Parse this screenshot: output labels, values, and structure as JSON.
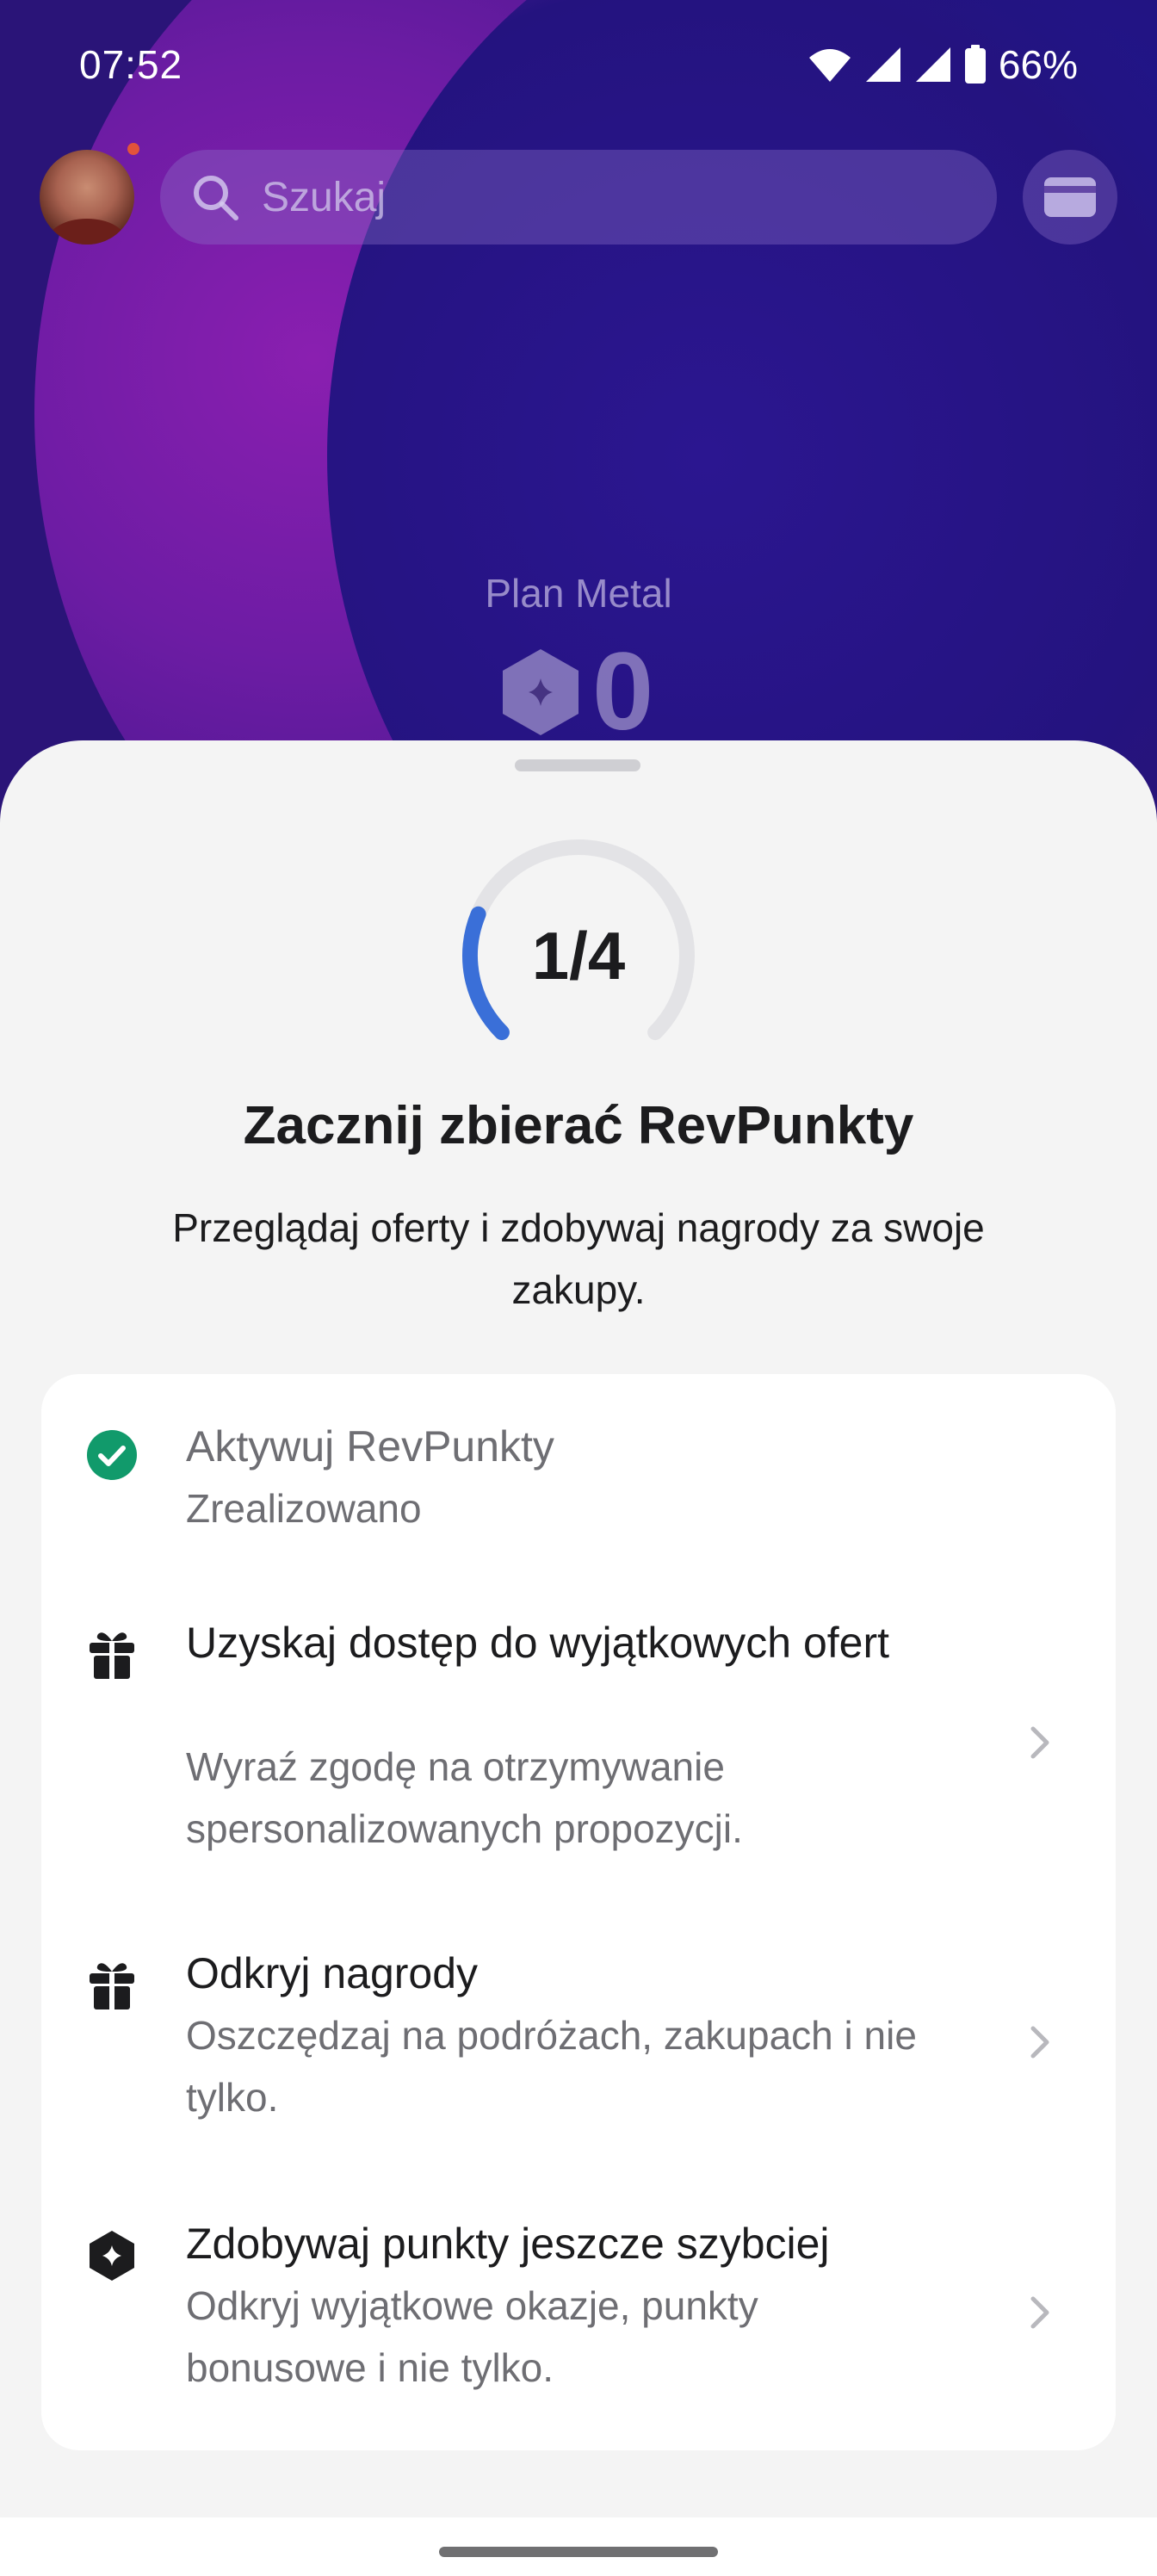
{
  "status_bar": {
    "time": "07:52",
    "battery": "66%"
  },
  "header": {
    "search_placeholder": "Szukaj"
  },
  "hero": {
    "plan_label": "Plan Metal",
    "points_value": "0"
  },
  "sheet": {
    "progress_text": "1/4",
    "progress_fraction": 0.25,
    "title": "Zacznij zbierać RevPunkty",
    "subtitle": "Przeglądaj oferty i zdobywaj nagrody za swoje zakupy."
  },
  "tasks": [
    {
      "icon": "check-circle-icon",
      "title": "Aktywuj RevPunkty",
      "description": "Zrealizowano",
      "completed": true
    },
    {
      "icon": "gift-icon",
      "title": "Uzyskaj dostęp do wyjątkowych ofert",
      "description": "Wyraź zgodę na otrzymywanie spersonalizowanych propozycji.",
      "completed": false
    },
    {
      "icon": "gift-icon",
      "title": "Odkryj nagrody",
      "description": "Oszczędzaj na podróżach, zakupach i nie tylko.",
      "completed": false
    },
    {
      "icon": "hexagon-sparkle-icon",
      "title": "Zdobywaj punkty jeszcze szybciej",
      "description": "Odkryj wyjątkowe okazje, punkty bonusowe i nie tylko.",
      "completed": false
    }
  ],
  "colors": {
    "accent_blue": "#3a6fd8",
    "check_green": "#119a6b",
    "background_purple": "#2a1580"
  }
}
